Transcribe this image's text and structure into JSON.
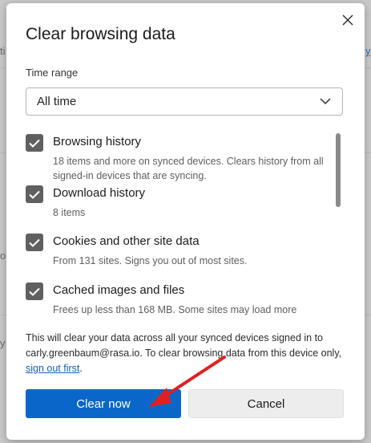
{
  "background": {
    "right_link_fragment": "y",
    "left_fragments": [
      "ti",
      "o",
      "y"
    ]
  },
  "dialog": {
    "title": "Clear browsing data",
    "close_icon": "close-icon",
    "time_range": {
      "label": "Time range",
      "selected": "All time"
    },
    "items": [
      {
        "title": "Browsing history",
        "description": "18 items and more on synced devices. Clears history from all signed-in devices that are syncing.",
        "checked": true
      },
      {
        "title": "Download history",
        "description": "8 items",
        "checked": true
      },
      {
        "title": "Cookies and other site data",
        "description": "From 131 sites. Signs you out of most sites.",
        "checked": true
      },
      {
        "title": "Cached images and files",
        "description": "Frees up less than 168 MB. Some sites may load more",
        "checked": true
      }
    ],
    "notice": {
      "text": "This will clear your data across all your synced devices signed in to carly.greenbaum@rasa.io. To clear browsing data from this device only, ",
      "link": "sign out first",
      "end": "."
    },
    "buttons": {
      "primary": "Clear now",
      "secondary": "Cancel"
    },
    "accent_color": "#0a67c9",
    "annotation_color": "#e02020"
  }
}
